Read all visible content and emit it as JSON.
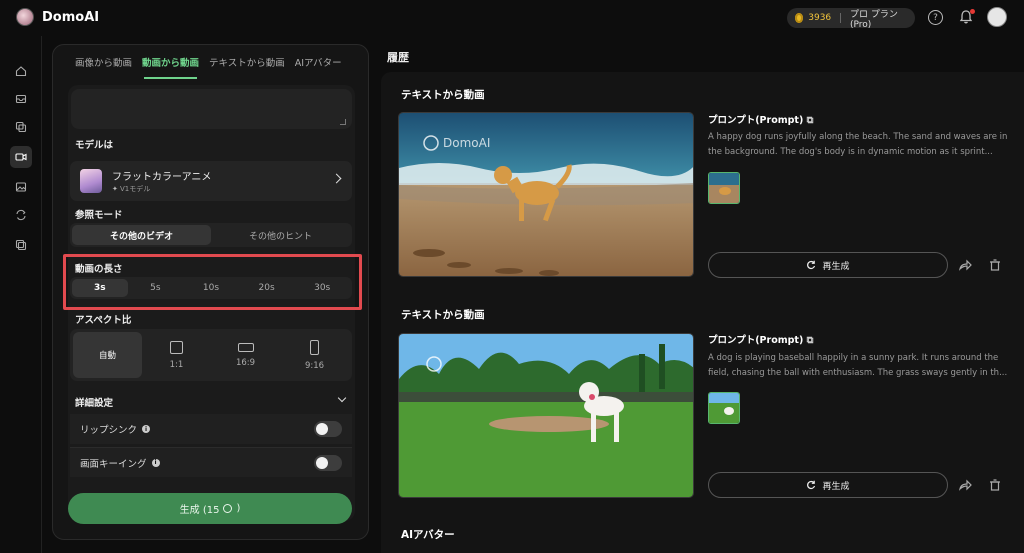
{
  "app": {
    "name": "DomoAI"
  },
  "header": {
    "credits": "3936",
    "plan": "プロ プラン(Pro)"
  },
  "tabs": [
    {
      "label": "画像から動画"
    },
    {
      "label": "動画から動画"
    },
    {
      "label": "テキストから動画"
    },
    {
      "label": "AIアバター"
    }
  ],
  "model": {
    "section_label": "モデルは",
    "name": "フラットカラーアニメ",
    "version": "V1モデル"
  },
  "reference_mode": {
    "label": "参照モード",
    "options": [
      "その他のビデオ",
      "その他のヒント"
    ],
    "selected": "その他のビデオ"
  },
  "duration": {
    "label": "動画の長さ",
    "options": [
      "3s",
      "5s",
      "10s",
      "20s",
      "30s"
    ],
    "selected": "3s"
  },
  "aspect": {
    "label": "アスペクト比",
    "options": [
      {
        "label": "自動",
        "icon": "none"
      },
      {
        "label": "1:1",
        "icon": "square-icon"
      },
      {
        "label": "16:9",
        "icon": "landscape-icon"
      },
      {
        "label": "9:16",
        "icon": "portrait-icon"
      }
    ],
    "selected": "自動"
  },
  "advanced": {
    "label": "詳細設定",
    "toggles": [
      {
        "label": "リップシンク",
        "on": false
      },
      {
        "label": "画面キーイング",
        "on": false
      }
    ]
  },
  "generate": {
    "label": "生成 (15",
    "label_end": ")"
  },
  "history": {
    "title": "履歴",
    "items": [
      {
        "type": "テキストから動画",
        "prompt_label": "プロンプト(Prompt)",
        "watermark": "DomoAI",
        "prompt": "A happy dog runs joyfully along the beach. The sand and waves are in the background. The dog's body is in dynamic motion as it sprint...",
        "regen_label": "再生成"
      },
      {
        "type": "テキストから動画",
        "prompt_label": "プロンプト(Prompt)",
        "prompt": "A dog is playing baseball happily in a sunny park. It runs around the field, chasing the ball with enthusiasm. The grass sways gently in th...",
        "regen_label": "再生成"
      }
    ],
    "next_section": "AIアバター"
  },
  "colors": {
    "accent_green": "#6fd38c",
    "generate_button": "#3f8a52",
    "highlight_red": "#e24a4f",
    "credit_gold": "#f0c33c"
  }
}
